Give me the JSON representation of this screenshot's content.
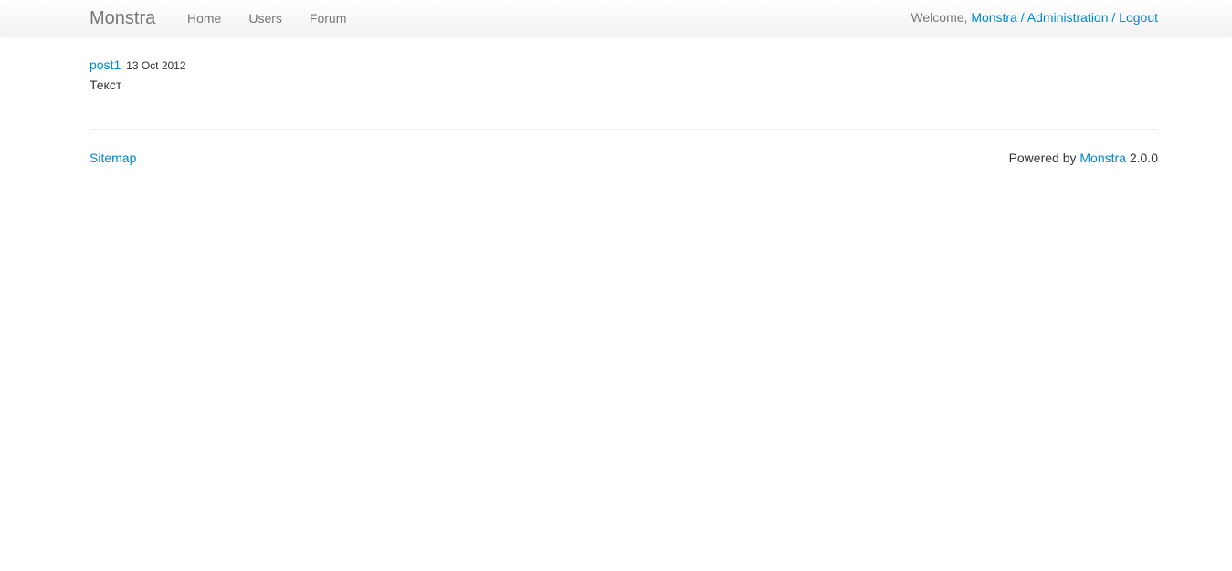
{
  "navbar": {
    "brand": "Monstra",
    "links": [
      {
        "label": "Home"
      },
      {
        "label": "Users"
      },
      {
        "label": "Forum"
      }
    ],
    "welcome_text": "Welcome, ",
    "user_link": "Monstra",
    "separator": " / ",
    "admin_link": "Administration",
    "logout_link": "Logout"
  },
  "post": {
    "title": "post1",
    "date": "13 Oct 2012",
    "body": "Текст"
  },
  "footer": {
    "sitemap_link": "Sitemap",
    "powered_prefix": "Powered by ",
    "powered_link": "Monstra",
    "version": " 2.0.0"
  },
  "colors": {
    "link": "#0088cc",
    "nav_text": "#777777",
    "text": "#333333"
  }
}
